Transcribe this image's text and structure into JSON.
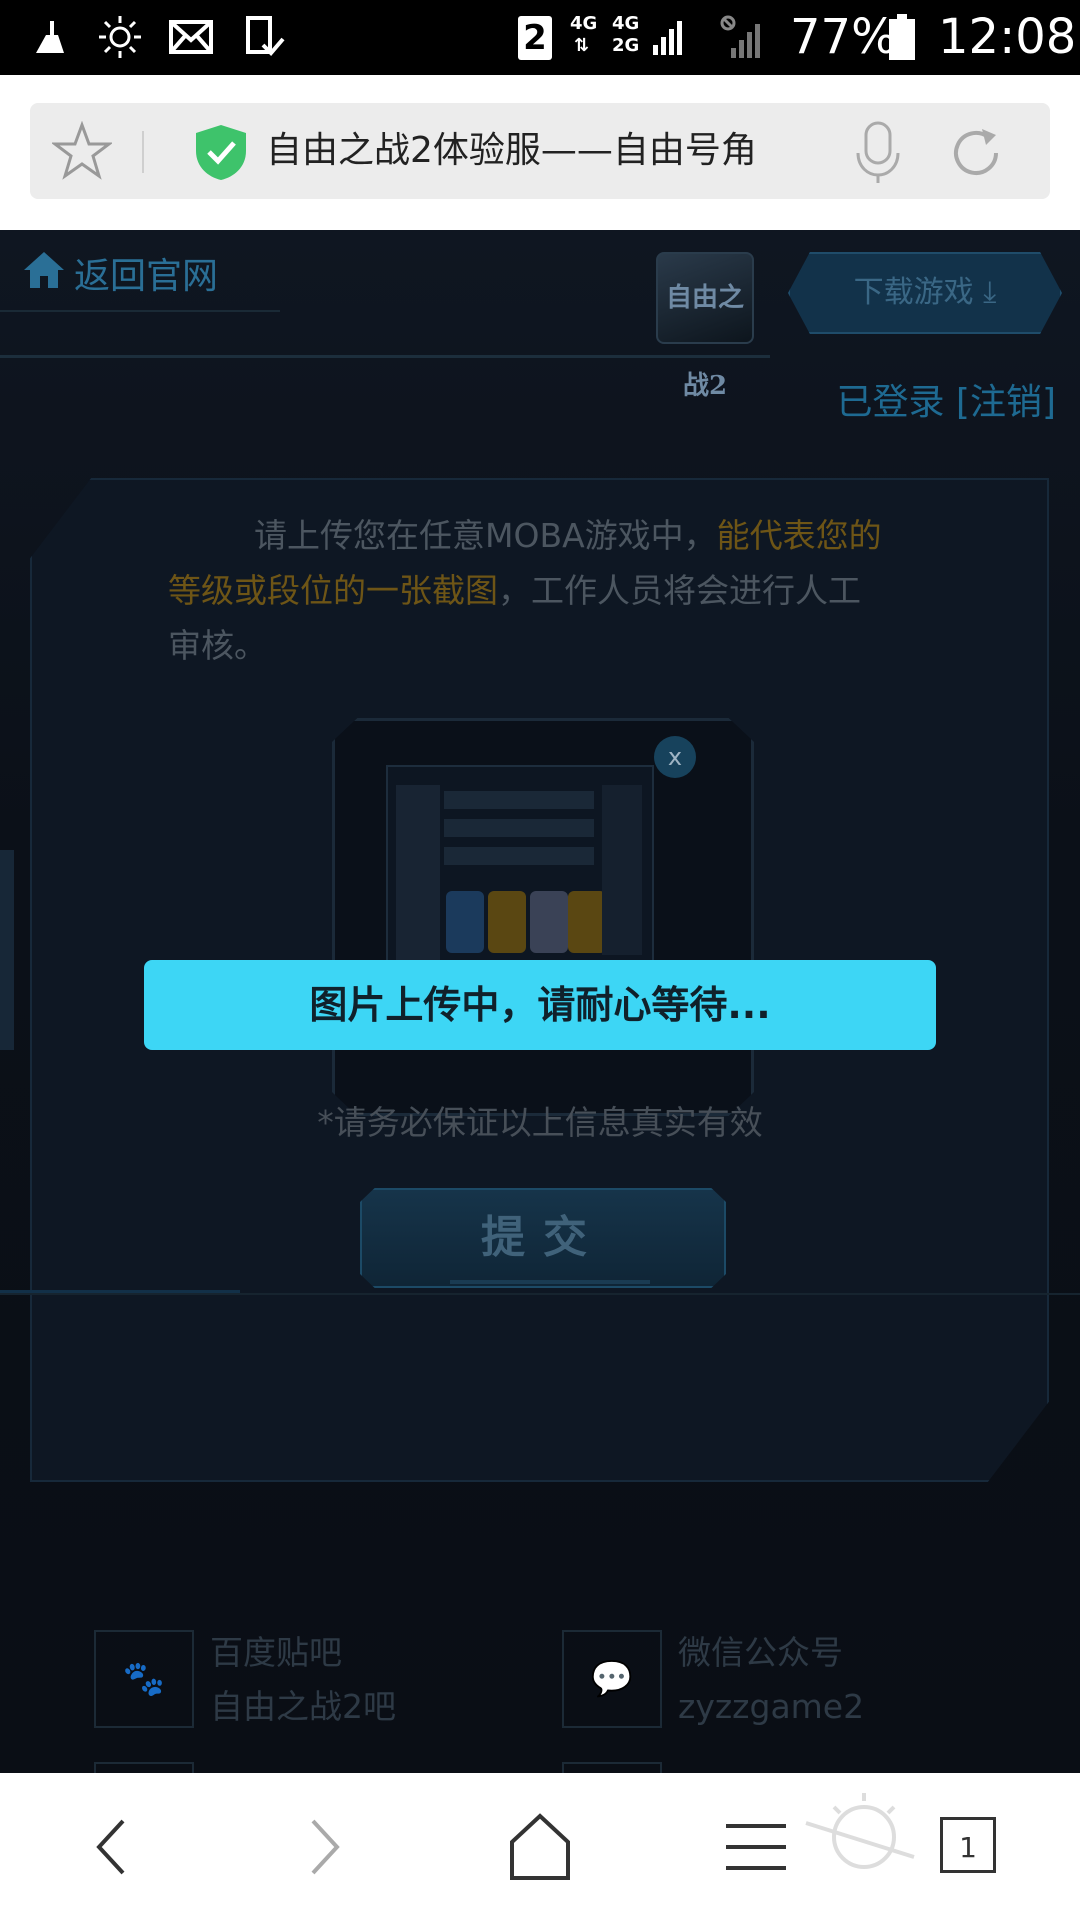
{
  "status_bar": {
    "sim_label": "2",
    "network_top": "4G",
    "network_mid": "4G",
    "network_low": "2G",
    "battery": "77%",
    "time": "12:08"
  },
  "browser": {
    "page_title": "自由之战2体验服——自由号角"
  },
  "header": {
    "back_label": "返回官网",
    "logo_text": "自由之战2",
    "download_label": "下载游戏 ⤓",
    "login_status": "已登录 [注销]"
  },
  "upload": {
    "instruction_prefix": "请上传您在任意MOBA游戏中，",
    "instruction_highlight": "能代表您的等级或段位的一张截图",
    "instruction_suffix": "，工作人员将会进行人工审核。",
    "remove_label": "x",
    "note": "*请务必保证以上信息真实有效",
    "submit_label": "提交"
  },
  "toast": {
    "message": "图片上传中，请耐心等待..."
  },
  "footer": {
    "items": [
      {
        "name": "百度贴吧",
        "value": "自由之战2吧"
      },
      {
        "name": "微信公众号",
        "value": "zyzzgame2"
      }
    ]
  },
  "bottom_nav": {
    "tab_count": "1"
  },
  "colors": {
    "toast_bg": "#3dd6f5",
    "highlight": "#6e5516",
    "link": "#1e6a92"
  }
}
